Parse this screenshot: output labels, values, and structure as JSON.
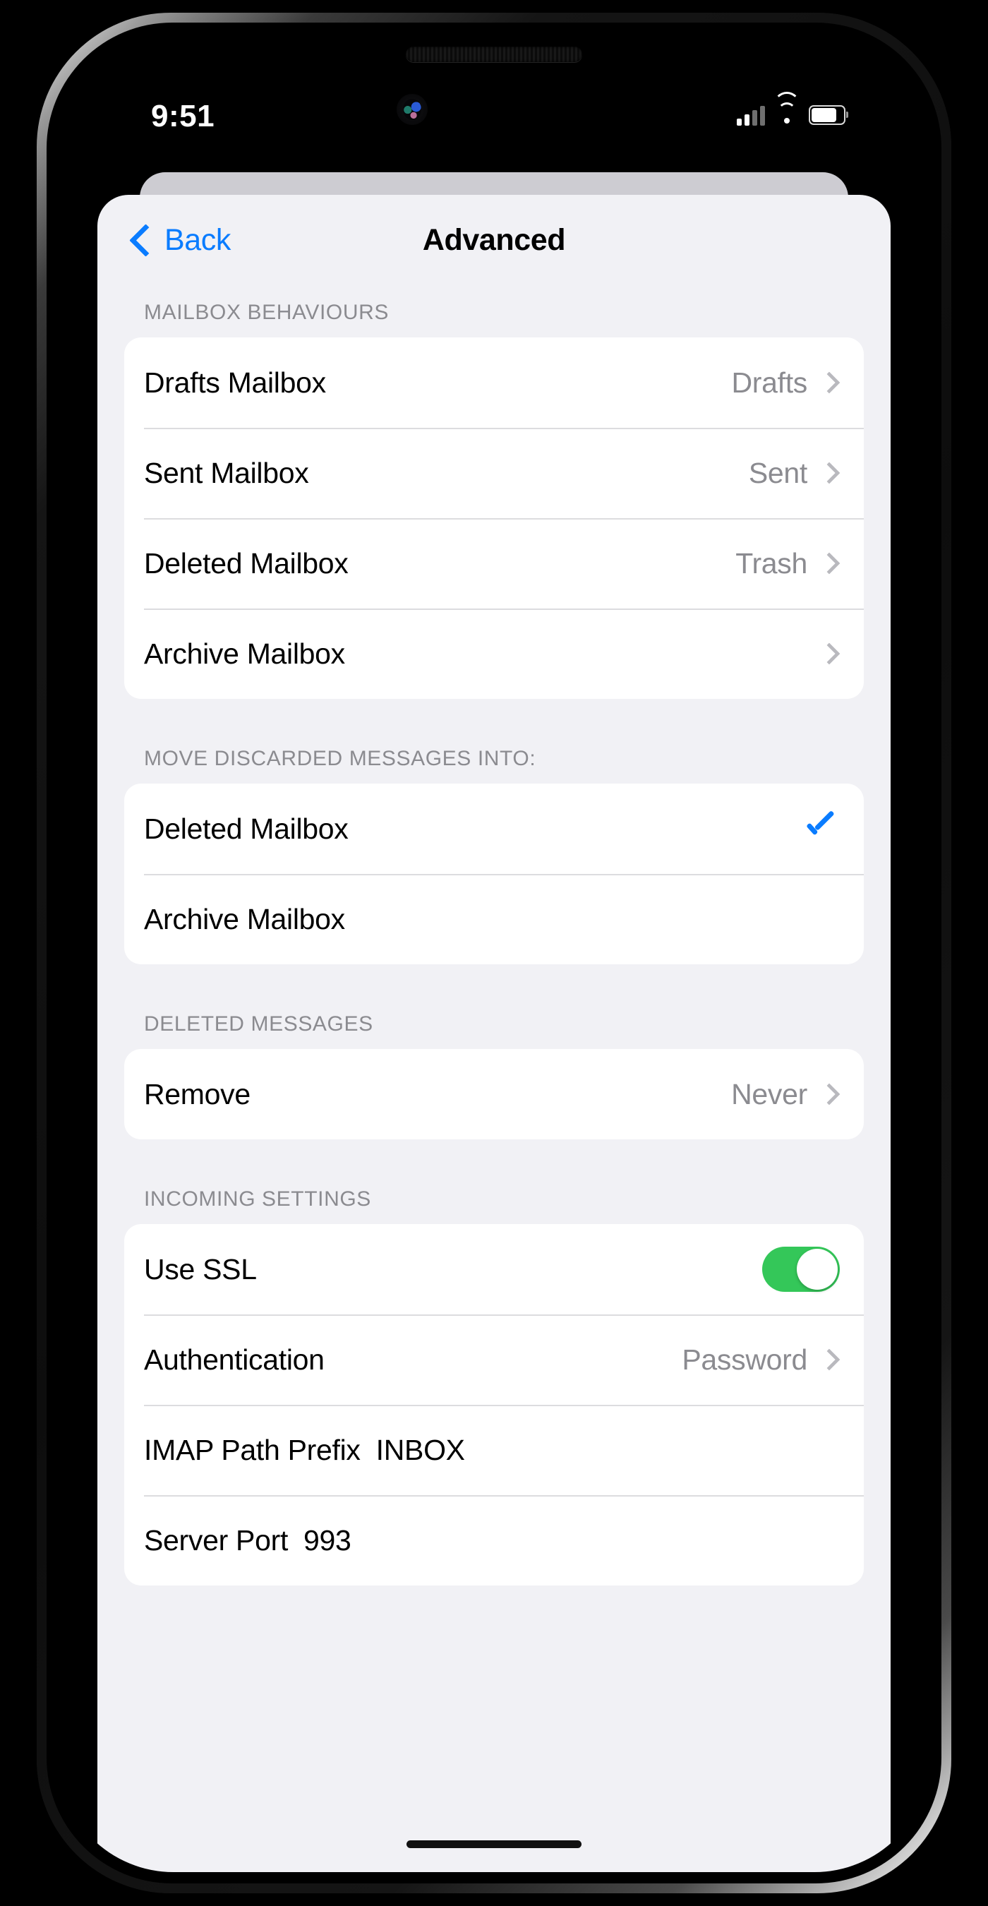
{
  "status_bar": {
    "time": "9:51",
    "cellular_icon": "cellular-signal-icon",
    "wifi_icon": "wifi-icon",
    "battery_icon": "battery-icon"
  },
  "nav": {
    "back_label": "Back",
    "back_icon": "chevron-left-icon",
    "title": "Advanced"
  },
  "sections": [
    {
      "header": "MAILBOX BEHAVIOURS",
      "rows": [
        {
          "label": "Drafts Mailbox",
          "value": "Drafts",
          "accessory": "chevron"
        },
        {
          "label": "Sent Mailbox",
          "value": "Sent",
          "accessory": "chevron"
        },
        {
          "label": "Deleted Mailbox",
          "value": "Trash",
          "accessory": "chevron"
        },
        {
          "label": "Archive Mailbox",
          "value": "",
          "accessory": "chevron"
        }
      ]
    },
    {
      "header": "MOVE DISCARDED MESSAGES INTO:",
      "rows": [
        {
          "label": "Deleted Mailbox",
          "value": "",
          "accessory": "check"
        },
        {
          "label": "Archive Mailbox",
          "value": "",
          "accessory": "none"
        }
      ]
    },
    {
      "header": "DELETED MESSAGES",
      "rows": [
        {
          "label": "Remove",
          "value": "Never",
          "accessory": "chevron"
        }
      ]
    },
    {
      "header": "INCOMING SETTINGS",
      "rows": [
        {
          "label": "Use SSL",
          "value": "",
          "accessory": "toggle-on"
        },
        {
          "label": "Authentication",
          "value": "Password",
          "accessory": "chevron"
        },
        {
          "label": "IMAP Path Prefix",
          "inline": "INBOX",
          "accessory": "none"
        },
        {
          "label": "Server Port",
          "inline": "993",
          "accessory": "none"
        }
      ]
    }
  ],
  "colors": {
    "accent_blue": "#0A7CFF",
    "toggle_green": "#34C759",
    "group_background": "#F1F1F5",
    "cell_background": "#FFFFFF",
    "secondary_text": "#8B8B90"
  },
  "home_indicator": "home-indicator"
}
